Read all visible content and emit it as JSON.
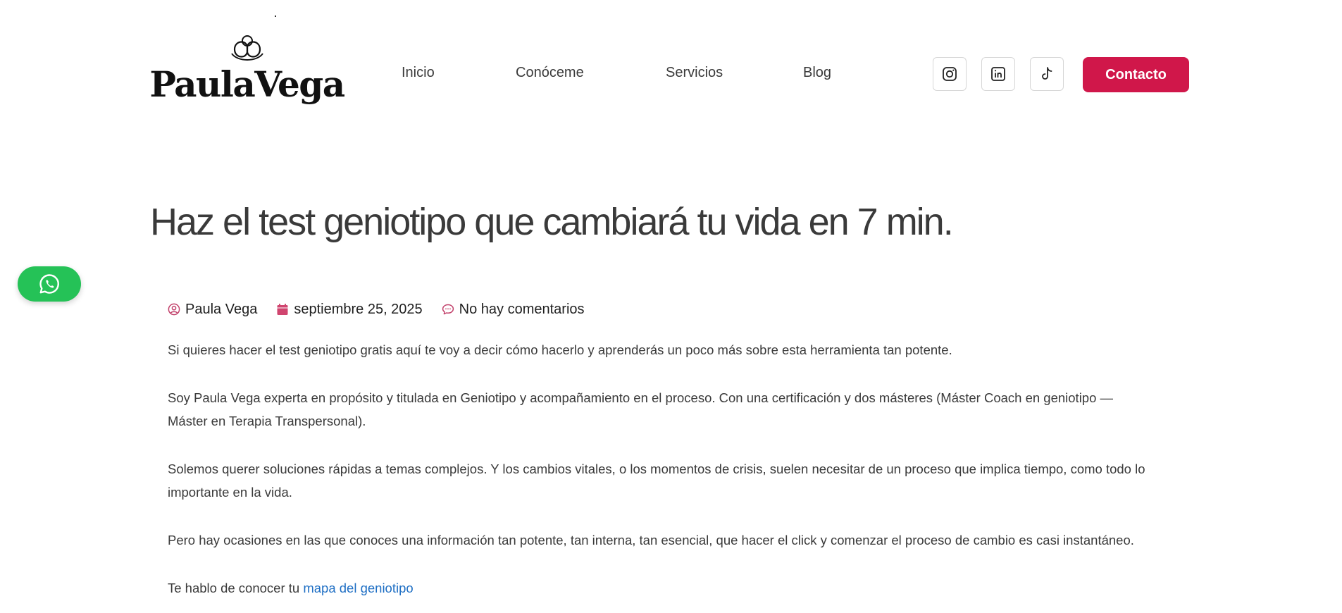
{
  "colors": {
    "accent": "#d0174a",
    "whatsapp": "#25c257",
    "link": "#1f6fc4",
    "text": "#3a3a3a"
  },
  "header": {
    "logo_text": "PaulaVega",
    "nav": [
      {
        "label": "Inicio"
      },
      {
        "label": "Conóceme"
      },
      {
        "label": "Servicios"
      },
      {
        "label": "Blog"
      }
    ],
    "social": [
      {
        "icon": "instagram-icon"
      },
      {
        "icon": "linkedin-icon"
      },
      {
        "icon": "tiktok-icon"
      }
    ],
    "contact_label": "Contacto"
  },
  "floating": {
    "icon": "whatsapp-icon"
  },
  "article": {
    "title": "Haz el test geniotipo que cambiará tu vida en 7 min.",
    "meta": {
      "author": "Paula Vega",
      "date": "septiembre 25, 2025",
      "comments": "No hay comentarios"
    },
    "paragraphs": [
      "Si quieres hacer el test geniotipo gratis aquí te voy a decir cómo hacerlo y aprenderás un poco más sobre esta herramienta tan potente.",
      "Soy Paula Vega experta en propósito y titulada en Geniotipo y acompañamiento en el proceso. Con una certificación y dos másteres (Máster Coach en geniotipo — Máster en Terapia Transpersonal).",
      "Solemos querer soluciones rápidas a temas complejos. Y los cambios vitales, o los momentos de crisis, suelen necesitar de un proceso que implica tiempo, como todo lo importante en la vida.",
      "Pero hay ocasiones en las que conoces una información tan potente, tan interna, tan esencial, que hacer el click y comenzar el proceso de cambio es casi instantáneo."
    ],
    "last_paragraph_prefix": "Te hablo de conocer tu ",
    "last_paragraph_link": "mapa del geniotipo"
  }
}
